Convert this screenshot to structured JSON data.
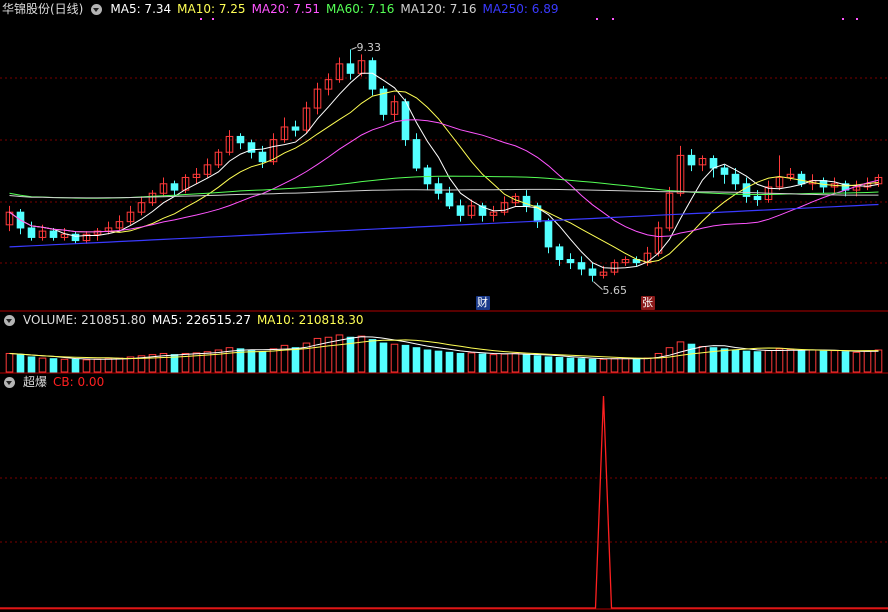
{
  "colors": {
    "up": "#ff3a3a",
    "down": "#54ffff",
    "ma5": "#ffffff",
    "ma10": "#ffff55",
    "ma20": "#ff55ff",
    "ma60": "#55ff55",
    "ma120": "#d0d0d0",
    "ma250": "#3a3aff",
    "grid": "#7a0000",
    "frame": "#b00000",
    "cb": "#ff2020",
    "vol_ma5": "#ffffff",
    "vol_ma10": "#ffff55"
  },
  "main": {
    "title": "华锦股份(日线)",
    "ma_labels": [
      {
        "text": "MA5: 7.34",
        "color": "#ffffff"
      },
      {
        "text": "MA10: 7.25",
        "color": "#ffff55"
      },
      {
        "text": "MA20: 7.51",
        "color": "#ff55ff"
      },
      {
        "text": "MA60: 7.16",
        "color": "#55ff55"
      },
      {
        "text": "MA120: 7.16",
        "color": "#d0d0d0"
      },
      {
        "text": "MA250: 6.89",
        "color": "#3a3aff"
      }
    ],
    "high_label": "9.33",
    "low_label": "5.65",
    "tag1": "财",
    "tag2": "张",
    "indicator_icon": "chevron-down-icon"
  },
  "volume": {
    "title": "VOLUME: 210851.80",
    "ma5": "MA5: 226515.27",
    "ma10": "MA10: 210818.30"
  },
  "cb": {
    "title": "超爆",
    "value": "CB: 0.00"
  },
  "chart_data": {
    "type": "candlestick",
    "price_range": [
      5.2,
      9.7
    ],
    "candles": [
      [
        6.55,
        6.75,
        6.45,
        6.85
      ],
      [
        6.75,
        6.5,
        6.4,
        6.8
      ],
      [
        6.5,
        6.35,
        6.3,
        6.6
      ],
      [
        6.35,
        6.45,
        6.3,
        6.55
      ],
      [
        6.45,
        6.35,
        6.3,
        6.5
      ],
      [
        6.35,
        6.4,
        6.3,
        6.5
      ],
      [
        6.4,
        6.3,
        6.25,
        6.45
      ],
      [
        6.3,
        6.4,
        6.25,
        6.45
      ],
      [
        6.4,
        6.45,
        6.3,
        6.5
      ],
      [
        6.45,
        6.5,
        6.4,
        6.6
      ],
      [
        6.5,
        6.6,
        6.45,
        6.7
      ],
      [
        6.6,
        6.75,
        6.55,
        6.85
      ],
      [
        6.75,
        6.9,
        6.7,
        7.0
      ],
      [
        6.9,
        7.05,
        6.85,
        7.1
      ],
      [
        7.05,
        7.2,
        7.0,
        7.3
      ],
      [
        7.2,
        7.1,
        7.0,
        7.25
      ],
      [
        7.1,
        7.3,
        7.05,
        7.35
      ],
      [
        7.3,
        7.35,
        7.2,
        7.45
      ],
      [
        7.35,
        7.5,
        7.3,
        7.6
      ],
      [
        7.5,
        7.7,
        7.45,
        7.75
      ],
      [
        7.7,
        7.95,
        7.65,
        8.05
      ],
      [
        7.95,
        7.85,
        7.75,
        8.0
      ],
      [
        7.85,
        7.7,
        7.6,
        7.9
      ],
      [
        7.7,
        7.55,
        7.45,
        7.8
      ],
      [
        7.55,
        7.9,
        7.5,
        8.0
      ],
      [
        7.9,
        8.1,
        7.85,
        8.25
      ],
      [
        8.1,
        8.05,
        7.95,
        8.2
      ],
      [
        8.05,
        8.4,
        8.0,
        8.5
      ],
      [
        8.4,
        8.7,
        8.3,
        8.8
      ],
      [
        8.7,
        8.85,
        8.6,
        8.95
      ],
      [
        8.85,
        9.1,
        8.8,
        9.2
      ],
      [
        9.1,
        8.95,
        8.85,
        9.33
      ],
      [
        8.95,
        9.15,
        8.9,
        9.25
      ],
      [
        9.15,
        8.7,
        8.6,
        9.2
      ],
      [
        8.7,
        8.3,
        8.2,
        8.75
      ],
      [
        8.3,
        8.5,
        8.2,
        8.6
      ],
      [
        8.5,
        7.9,
        7.8,
        8.55
      ],
      [
        7.9,
        7.45,
        7.4,
        8.0
      ],
      [
        7.45,
        7.2,
        7.1,
        7.5
      ],
      [
        7.2,
        7.05,
        6.95,
        7.3
      ],
      [
        7.05,
        6.85,
        6.8,
        7.15
      ],
      [
        6.85,
        6.7,
        6.6,
        6.95
      ],
      [
        6.7,
        6.85,
        6.65,
        6.95
      ],
      [
        6.85,
        6.7,
        6.6,
        6.9
      ],
      [
        6.7,
        6.75,
        6.6,
        6.85
      ],
      [
        6.75,
        6.9,
        6.7,
        7.0
      ],
      [
        6.9,
        7.0,
        6.85,
        7.05
      ],
      [
        7.0,
        6.85,
        6.75,
        7.1
      ],
      [
        6.85,
        6.6,
        6.5,
        6.9
      ],
      [
        6.6,
        6.2,
        6.1,
        6.65
      ],
      [
        6.2,
        6.0,
        5.9,
        6.25
      ],
      [
        6.0,
        5.95,
        5.85,
        6.1
      ],
      [
        5.95,
        5.85,
        5.75,
        6.05
      ],
      [
        5.85,
        5.75,
        5.65,
        5.95
      ],
      [
        5.75,
        5.8,
        5.7,
        5.9
      ],
      [
        5.8,
        5.95,
        5.75,
        6.0
      ],
      [
        5.95,
        6.0,
        5.9,
        6.05
      ],
      [
        6.0,
        5.95,
        5.9,
        6.05
      ],
      [
        5.95,
        6.1,
        5.9,
        6.2
      ],
      [
        6.1,
        6.5,
        6.05,
        6.6
      ],
      [
        6.5,
        7.05,
        6.45,
        7.15
      ],
      [
        7.05,
        7.65,
        7.0,
        7.8
      ],
      [
        7.65,
        7.5,
        7.4,
        7.75
      ],
      [
        7.5,
        7.6,
        7.4,
        7.65
      ],
      [
        7.6,
        7.45,
        7.3,
        7.65
      ],
      [
        7.45,
        7.35,
        7.2,
        7.5
      ],
      [
        7.35,
        7.2,
        7.1,
        7.45
      ],
      [
        7.2,
        7.0,
        6.9,
        7.3
      ],
      [
        7.0,
        6.95,
        6.85,
        7.1
      ],
      [
        6.95,
        7.15,
        6.9,
        7.25
      ],
      [
        7.15,
        7.3,
        7.1,
        7.65
      ],
      [
        7.3,
        7.35,
        7.25,
        7.45
      ],
      [
        7.35,
        7.2,
        7.15,
        7.4
      ],
      [
        7.2,
        7.25,
        7.1,
        7.35
      ],
      [
        7.25,
        7.15,
        7.05,
        7.3
      ],
      [
        7.15,
        7.2,
        7.05,
        7.3
      ],
      [
        7.2,
        7.1,
        7.0,
        7.25
      ],
      [
        7.1,
        7.15,
        7.0,
        7.25
      ],
      [
        7.15,
        7.2,
        7.1,
        7.3
      ],
      [
        7.2,
        7.3,
        7.15,
        7.35
      ]
    ],
    "volume": [
      160,
      150,
      130,
      120,
      115,
      110,
      110,
      105,
      110,
      115,
      120,
      130,
      140,
      150,
      160,
      150,
      160,
      165,
      175,
      190,
      210,
      200,
      185,
      175,
      200,
      230,
      210,
      250,
      290,
      300,
      320,
      300,
      310,
      280,
      250,
      240,
      230,
      210,
      190,
      180,
      170,
      160,
      165,
      155,
      150,
      155,
      160,
      150,
      140,
      130,
      125,
      120,
      115,
      110,
      110,
      115,
      120,
      115,
      120,
      160,
      210,
      260,
      240,
      220,
      210,
      200,
      190,
      180,
      175,
      185,
      200,
      195,
      185,
      190,
      180,
      185,
      175,
      170,
      180,
      190
    ],
    "vol_range": [
      0,
      380
    ],
    "cb_value": 0.0,
    "cb_spike_index": 54
  }
}
